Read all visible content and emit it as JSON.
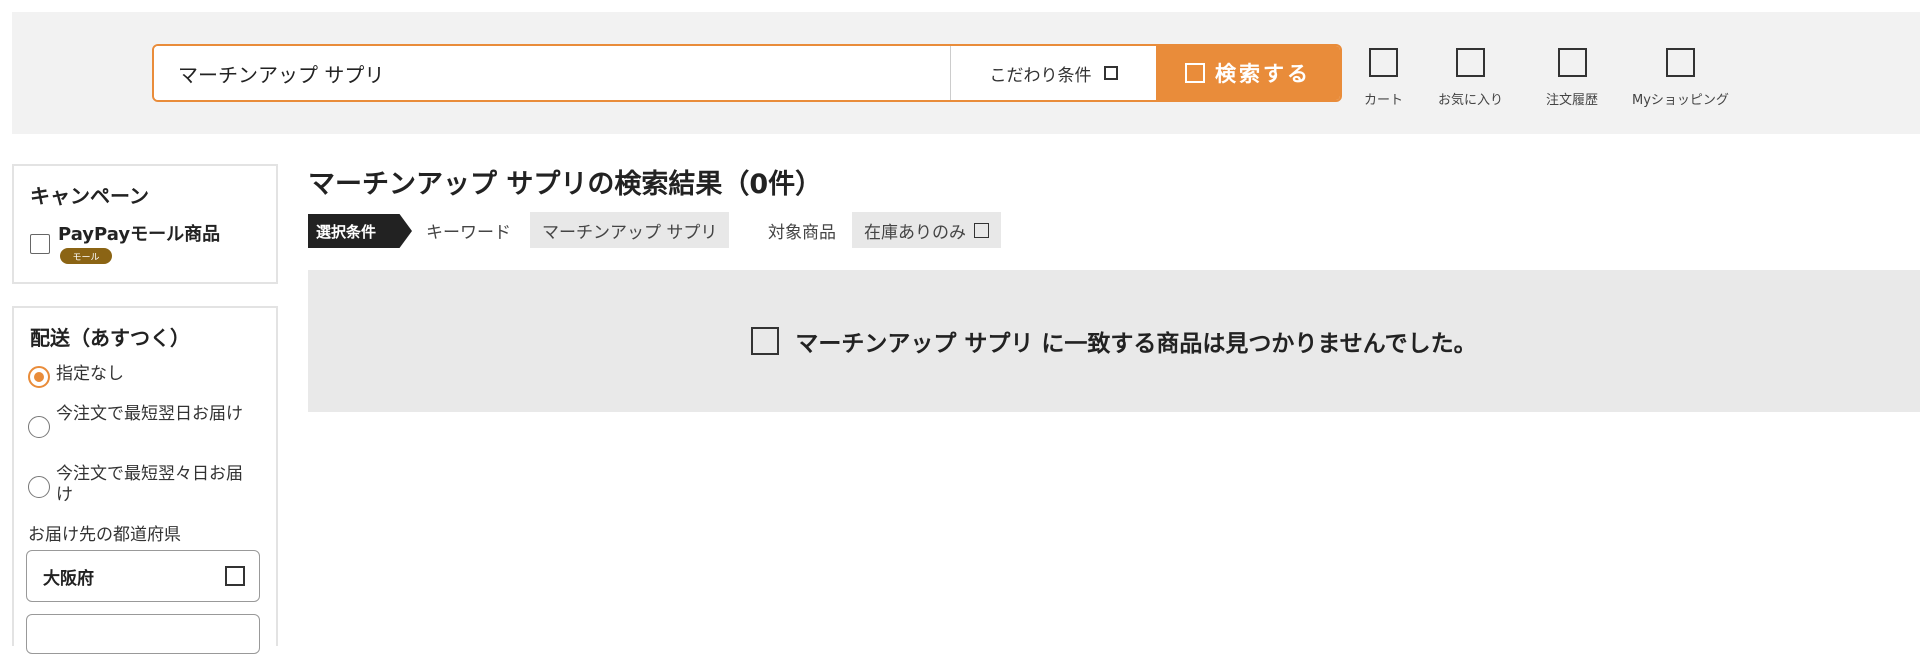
{
  "header": {
    "search_value": "マーチンアップ サプリ",
    "kodawari_label": "こだわり条件",
    "search_button_label": "検索する",
    "utility": [
      {
        "label": "カート",
        "icon": "cart-icon"
      },
      {
        "label": "お気に入り",
        "icon": "heart-icon"
      },
      {
        "label": "注文履歴",
        "icon": "history-icon"
      },
      {
        "label": "Myショッピング",
        "icon": "user-icon"
      }
    ]
  },
  "sidebar": {
    "campaign": {
      "title": "キャンペーン",
      "paypay_label": "PayPayモール商品",
      "mall_badge": "モール"
    },
    "shipping": {
      "title": "配送（あすつく）",
      "options": [
        {
          "label": "指定なし",
          "checked": true
        },
        {
          "label": "今注文で最短翌日お届け",
          "checked": false
        },
        {
          "label": "今注文で最短翌々日お届け",
          "checked": false
        }
      ],
      "prefecture_label": "お届け先の都道府県",
      "prefecture_value": "大阪府"
    }
  },
  "main": {
    "result_title": "マーチンアップ サプリの検索結果（0件）",
    "conditions": {
      "tag": "選択条件",
      "keyword_label": "キーワード",
      "keyword_value": "マーチンアップ サプリ",
      "target_label": "対象商品",
      "target_value": "在庫ありのみ"
    },
    "no_result_message": "マーチンアップ サプリ に一致する商品は見つかりませんでした。"
  },
  "colors": {
    "accent": "#e98c3a",
    "header_bg": "#f2f2f2",
    "badge": "#8b6414"
  }
}
